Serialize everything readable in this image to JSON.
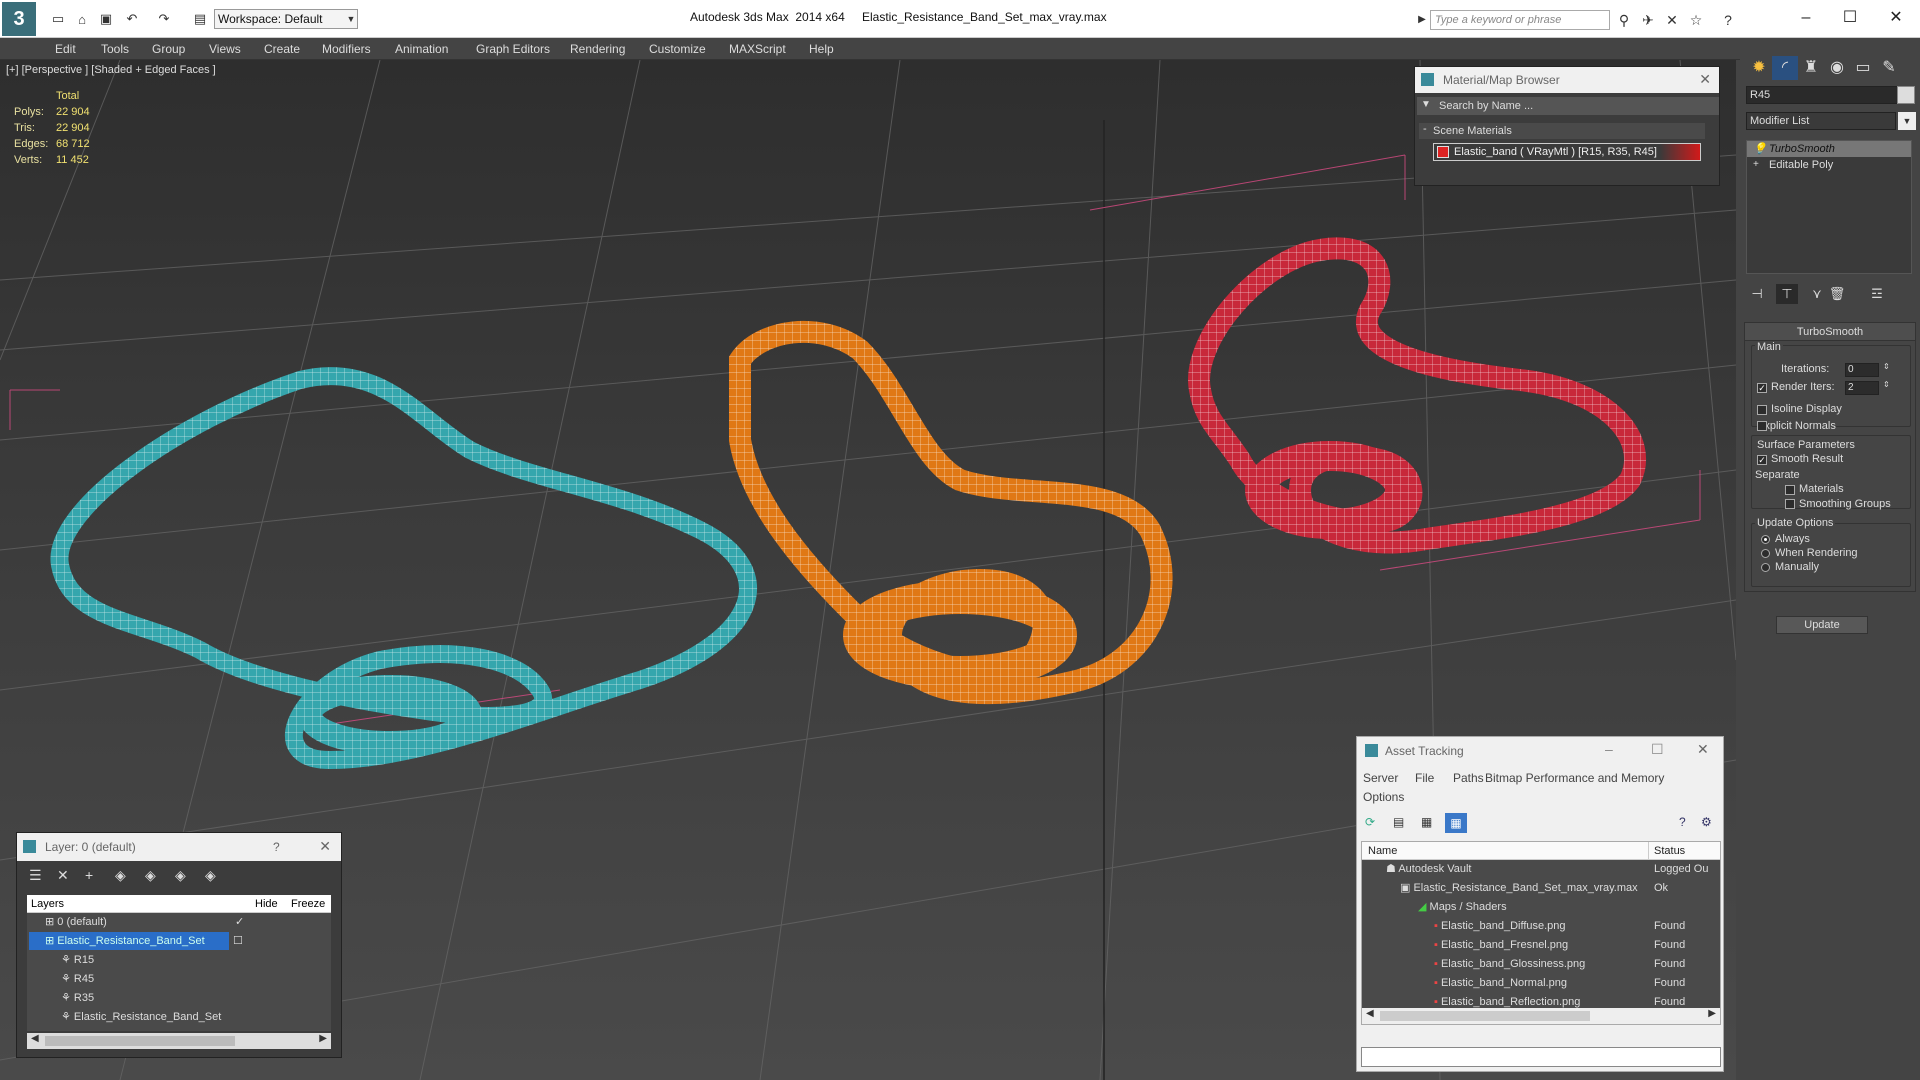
{
  "titlebar": {
    "app_title": "Autodesk 3ds Max  2014 x64",
    "file_title": "Elastic_Resistance_Band_Set_max_vray.max",
    "workspace": "Workspace: Default",
    "search_placeholder": "Type a keyword or phrase"
  },
  "menu": [
    "Edit",
    "Tools",
    "Group",
    "Views",
    "Create",
    "Modifiers",
    "Animation",
    "Graph Editors",
    "Rendering",
    "Customize",
    "MAXScript",
    "Help"
  ],
  "viewport": {
    "label": "[+] [Perspective ] [Shaded + Edged Faces ]",
    "stats_header": "Total",
    "stats": [
      {
        "k": "Polys:",
        "v": "22 904"
      },
      {
        "k": "Tris:",
        "v": "22 904"
      },
      {
        "k": "Edges:",
        "v": "68 712"
      },
      {
        "k": "Verts:",
        "v": "11 452"
      }
    ],
    "colors": {
      "band1": "#35a6ad",
      "band2": "#e07815",
      "band3": "#c8283a"
    }
  },
  "material_browser": {
    "title": "Material/Map Browser",
    "search": "Search by Name ...",
    "section": "Scene Materials",
    "material": "Elastic_band  ( VRayMtl ) [R15, R35, R45]"
  },
  "command_panel": {
    "object_name": "R45",
    "modifier_list": "Modifier List",
    "stack": [
      "TurboSmooth",
      "Editable Poly"
    ],
    "rollout_title": "TurboSmooth",
    "main_label": "Main",
    "iterations_label": "Iterations:",
    "iterations_value": "0",
    "render_iters_label": "Render Iters:",
    "render_iters_value": "2",
    "isoline": "Isoline Display",
    "explicit": "Explicit Normals",
    "surface_params": "Surface Parameters",
    "smooth_result": "Smooth Result",
    "separate": "Separate",
    "materials": "Materials",
    "smoothing_groups": "Smoothing Groups",
    "update_options": "Update Options",
    "always": "Always",
    "when_rendering": "When Rendering",
    "manually": "Manually",
    "update_btn": "Update"
  },
  "layer_panel": {
    "title": "Layer: 0 (default)",
    "help": "?",
    "col_layers": "Layers",
    "col_hide": "Hide",
    "col_freeze": "Freeze",
    "rows": [
      "0 (default)",
      "Elastic_Resistance_Band_Set",
      "R15",
      "R45",
      "R35",
      "Elastic_Resistance_Band_Set"
    ]
  },
  "asset_tracking": {
    "title": "Asset Tracking",
    "menu": [
      "Server",
      "File",
      "Paths",
      "Bitmap Performance and Memory",
      "Options"
    ],
    "col_name": "Name",
    "col_status": "Status",
    "rows": [
      {
        "name": "Autodesk Vault",
        "status": "Logged Ou"
      },
      {
        "name": "Elastic_Resistance_Band_Set_max_vray.max",
        "status": "Ok"
      },
      {
        "name": "Maps / Shaders",
        "status": ""
      },
      {
        "name": "Elastic_band_Diffuse.png",
        "status": "Found"
      },
      {
        "name": "Elastic_band_Fresnel.png",
        "status": "Found"
      },
      {
        "name": "Elastic_band_Glossiness.png",
        "status": "Found"
      },
      {
        "name": "Elastic_band_Normal.png",
        "status": "Found"
      },
      {
        "name": "Elastic_band_Reflection.png",
        "status": "Found"
      }
    ]
  }
}
